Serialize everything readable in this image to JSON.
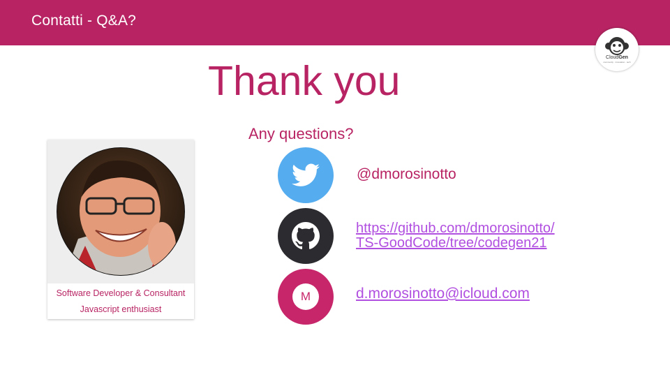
{
  "header": {
    "title": "Contatti - Q&A?"
  },
  "logo": {
    "name_part1": "Cloud",
    "name_part2": "Gen",
    "sub": "community · innovation · tech"
  },
  "main": {
    "title": "Thank you",
    "subtitle": "Any questions?"
  },
  "profile": {
    "role": "Software Developer & Consultant",
    "tagline": "Javascript enthusiast"
  },
  "contacts": {
    "twitter_handle": "@dmorosinotto",
    "github_line1": "https://github.com/dmorosinotto/",
    "github_line2": "TS-GoodCode/tree/codegen21",
    "email": "d.morosinotto@icloud.com",
    "mail_icon_letter": "M"
  },
  "colors": {
    "brand": "#b82463",
    "twitter": "#55acee",
    "github": "#2c2c30",
    "mail": "#c7266a",
    "link": "#b14fe0"
  },
  "icons": [
    "twitter-bird-icon",
    "github-octocat-icon",
    "mail-icon",
    "monkey-logo-icon"
  ]
}
